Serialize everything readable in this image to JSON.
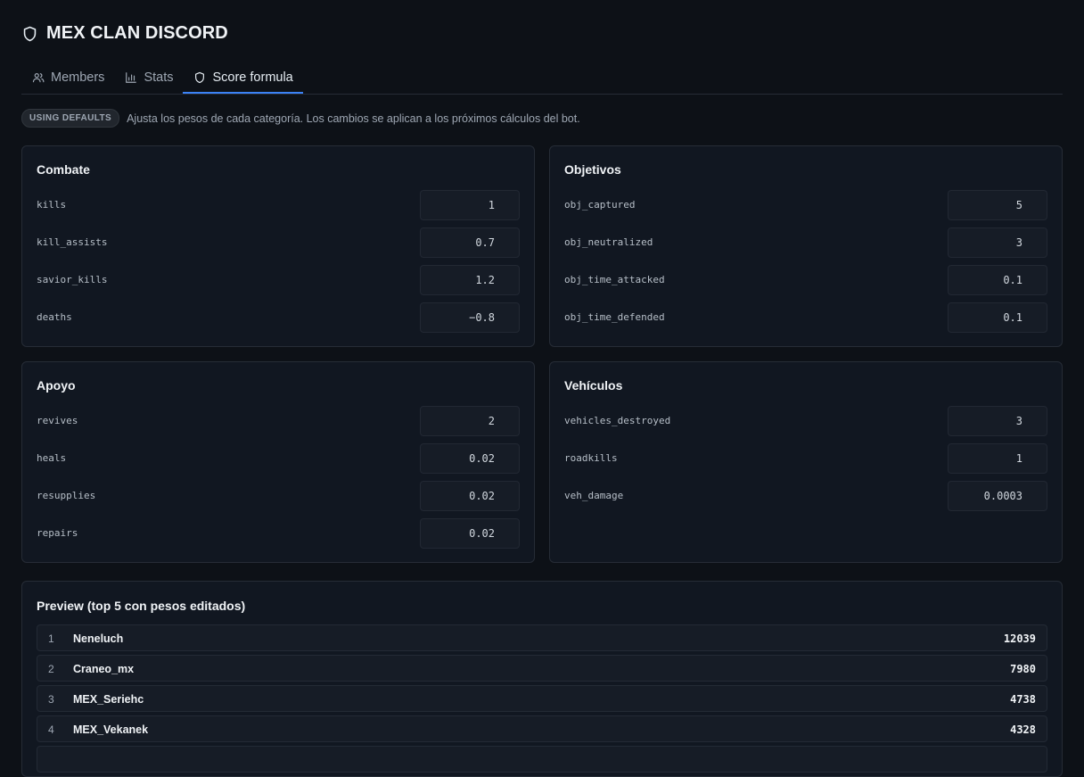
{
  "app": {
    "title": "MEX CLAN DISCORD"
  },
  "tabs": [
    {
      "label": "Members",
      "icon": "users-icon"
    },
    {
      "label": "Stats",
      "icon": "bar-chart-icon"
    },
    {
      "label": "Score formula",
      "icon": "shield-icon",
      "active": true
    }
  ],
  "notice": {
    "badge": "USING DEFAULTS",
    "text": "Ajusta los pesos de cada categoría. Los cambios se aplican a los próximos cálculos del bot."
  },
  "categories": {
    "combate": {
      "title": "Combate",
      "fields": [
        {
          "key": "kills",
          "value": "1"
        },
        {
          "key": "kill_assists",
          "value": "0.7"
        },
        {
          "key": "savior_kills",
          "value": "1.2"
        },
        {
          "key": "deaths",
          "value": "−0.8"
        }
      ]
    },
    "objetivos": {
      "title": "Objetivos",
      "fields": [
        {
          "key": "obj_captured",
          "value": "5"
        },
        {
          "key": "obj_neutralized",
          "value": "3"
        },
        {
          "key": "obj_time_attacked",
          "value": "0.1"
        },
        {
          "key": "obj_time_defended",
          "value": "0.1"
        }
      ]
    },
    "apoyo": {
      "title": "Apoyo",
      "fields": [
        {
          "key": "revives",
          "value": "2"
        },
        {
          "key": "heals",
          "value": "0.02"
        },
        {
          "key": "resupplies",
          "value": "0.02"
        },
        {
          "key": "repairs",
          "value": "0.02"
        }
      ]
    },
    "vehiculos": {
      "title": "Vehículos",
      "fields": [
        {
          "key": "vehicles_destroyed",
          "value": "3"
        },
        {
          "key": "roadkills",
          "value": "1"
        },
        {
          "key": "veh_damage",
          "value": "0.0003"
        }
      ]
    }
  },
  "preview": {
    "title": "Preview (top 5 con pesos editados)",
    "rows": [
      {
        "rank": "1",
        "name": "Neneluch",
        "score": "12039"
      },
      {
        "rank": "2",
        "name": "Craneo_mx",
        "score": "7980"
      },
      {
        "rank": "3",
        "name": "MEX_Seriehc",
        "score": "4738"
      },
      {
        "rank": "4",
        "name": "MEX_Vekanek",
        "score": "4328"
      },
      {
        "rank": "",
        "name": "",
        "score": ""
      }
    ]
  },
  "colors": {
    "background": "#0d1117",
    "card": "#111721",
    "accent": "#3b82f6"
  }
}
